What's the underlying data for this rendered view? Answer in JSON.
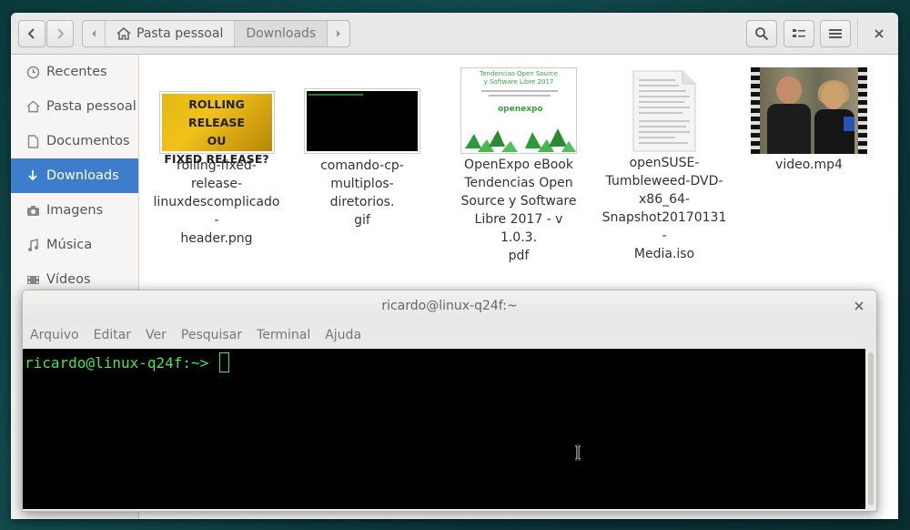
{
  "header": {
    "breadcrumb": [
      "Pasta pessoal",
      "Downloads"
    ]
  },
  "sidebar": {
    "items": [
      {
        "label": "Recentes",
        "icon": "clock-icon"
      },
      {
        "label": "Pasta pessoal",
        "icon": "home-icon"
      },
      {
        "label": "Documentos",
        "icon": "document-icon"
      },
      {
        "label": "Downloads",
        "icon": "download-icon",
        "selected": true
      },
      {
        "label": "Imagens",
        "icon": "camera-icon"
      },
      {
        "label": "Música",
        "icon": "music-icon"
      },
      {
        "label": "Vídeos",
        "icon": "film-icon"
      }
    ]
  },
  "files": [
    {
      "name": "rolling-fixed-release-linuxdescomplicado-header.png",
      "lines": [
        "rolling-fixed-release-",
        "linuxdescomplicado-",
        "header.png"
      ],
      "thumb_text": [
        "ROLLING RELEASE",
        "OU",
        "FIXED RELEASE?"
      ]
    },
    {
      "name": "comando-cp-multiplos-diretorios.gif",
      "lines": [
        "comando-cp-",
        "multiplos-diretorios.",
        "gif"
      ]
    },
    {
      "name": "OpenExpo eBook Tendencias Open Source y Software Libre 2017 - v 1.0.3.pdf",
      "lines": [
        "OpenExpo eBook",
        "Tendencias Open",
        "Source y Software",
        "Libre 2017 - v 1.0.3.",
        "pdf"
      ],
      "thumb_text": [
        "Tendencias Open Source",
        "y Software Libre 2017",
        "openexpo"
      ]
    },
    {
      "name": "openSUSE-Tumbleweed-DVD-x86_64-Snapshot20170131-Media.iso",
      "lines": [
        "openSUSE-",
        "Tumbleweed-DVD-",
        "x86_64-",
        "Snapshot20170131-",
        "Media.iso"
      ]
    },
    {
      "name": "video.mp4",
      "lines": [
        "video.mp4"
      ]
    }
  ],
  "terminal": {
    "title": "ricardo@linux-q24f:~",
    "menu": [
      "Arquivo",
      "Editar",
      "Ver",
      "Pesquisar",
      "Terminal",
      "Ajuda"
    ],
    "prompt": "ricardo@linux-q24f:~> "
  },
  "colors": {
    "selection": "#3d7dcb",
    "terminal_fg": "#4ee24e",
    "terminal_bg": "#000000"
  }
}
